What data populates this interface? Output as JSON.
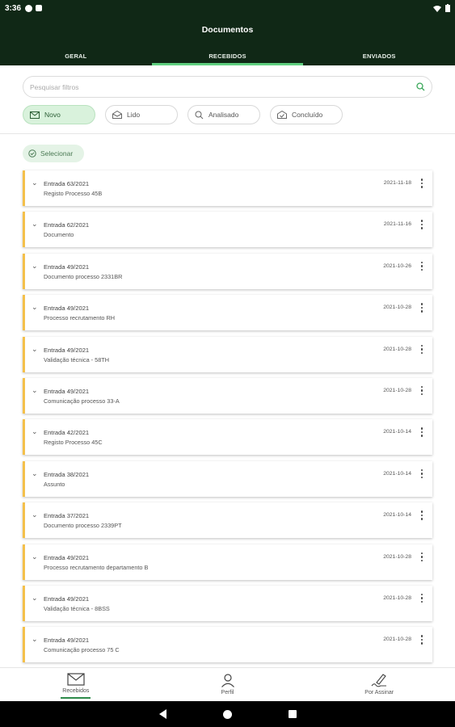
{
  "status": {
    "time": "3:36"
  },
  "header": {
    "title": "Documentos"
  },
  "tabs": [
    {
      "label": "GERAL"
    },
    {
      "label": "RECEBIDOS"
    },
    {
      "label": "ENVIADOS"
    }
  ],
  "search": {
    "placeholder": "Pesquisar filtros"
  },
  "chips": [
    {
      "label": "Novo",
      "icon": "envelope-icon"
    },
    {
      "label": "Lido",
      "icon": "envelope-open-icon"
    },
    {
      "label": "Analisado",
      "icon": "magnifier-icon"
    },
    {
      "label": "Concluído",
      "icon": "envelope-check-icon"
    }
  ],
  "select_label": "Selecionar",
  "documents": [
    {
      "title": "Entrada 63/2021",
      "subtitle": "Registo Processo 45B",
      "date": "2021-11-18"
    },
    {
      "title": "Entrada 62/2021",
      "subtitle": "Documento",
      "date": "2021-11-16"
    },
    {
      "title": "Entrada 49/2021",
      "subtitle": "Documento processo 2331BR",
      "date": "2021-10-26"
    },
    {
      "title": "Entrada 49/2021",
      "subtitle": "Processo recrutamento RH",
      "date": "2021-10-28"
    },
    {
      "title": "Entrada 49/2021",
      "subtitle": "Validação técnica - 58TH",
      "date": "2021-10-28"
    },
    {
      "title": "Entrada 49/2021",
      "subtitle": "Comunicação processo 33-A",
      "date": "2021-10-28"
    },
    {
      "title": "Entrada 42/2021",
      "subtitle": "Registo Processo 45C",
      "date": "2021-10-14"
    },
    {
      "title": "Entrada 38/2021",
      "subtitle": "Assunto",
      "date": "2021-10-14"
    },
    {
      "title": "Entrada 37/2021",
      "subtitle": "Documento processo 2339PT",
      "date": "2021-10-14"
    },
    {
      "title": "Entrada 49/2021",
      "subtitle": "Processo recrutamento departamento B",
      "date": "2021-10-28"
    },
    {
      "title": "Entrada 49/2021",
      "subtitle": "Validação técnica - 8BSS",
      "date": "2021-10-28"
    },
    {
      "title": "Entrada 49/2021",
      "subtitle": "Comunicação processo 75 C",
      "date": "2021-10-28"
    }
  ],
  "bottom_nav": [
    {
      "label": "Recebidos",
      "icon": "envelope-icon"
    },
    {
      "label": "Perfil",
      "icon": "person-icon"
    },
    {
      "label": "Por Assinar",
      "icon": "signature-pen-icon"
    }
  ],
  "colors": {
    "header_bg": "#102816",
    "accent": "#5fcf7f",
    "card_border": "#f4c04b"
  }
}
